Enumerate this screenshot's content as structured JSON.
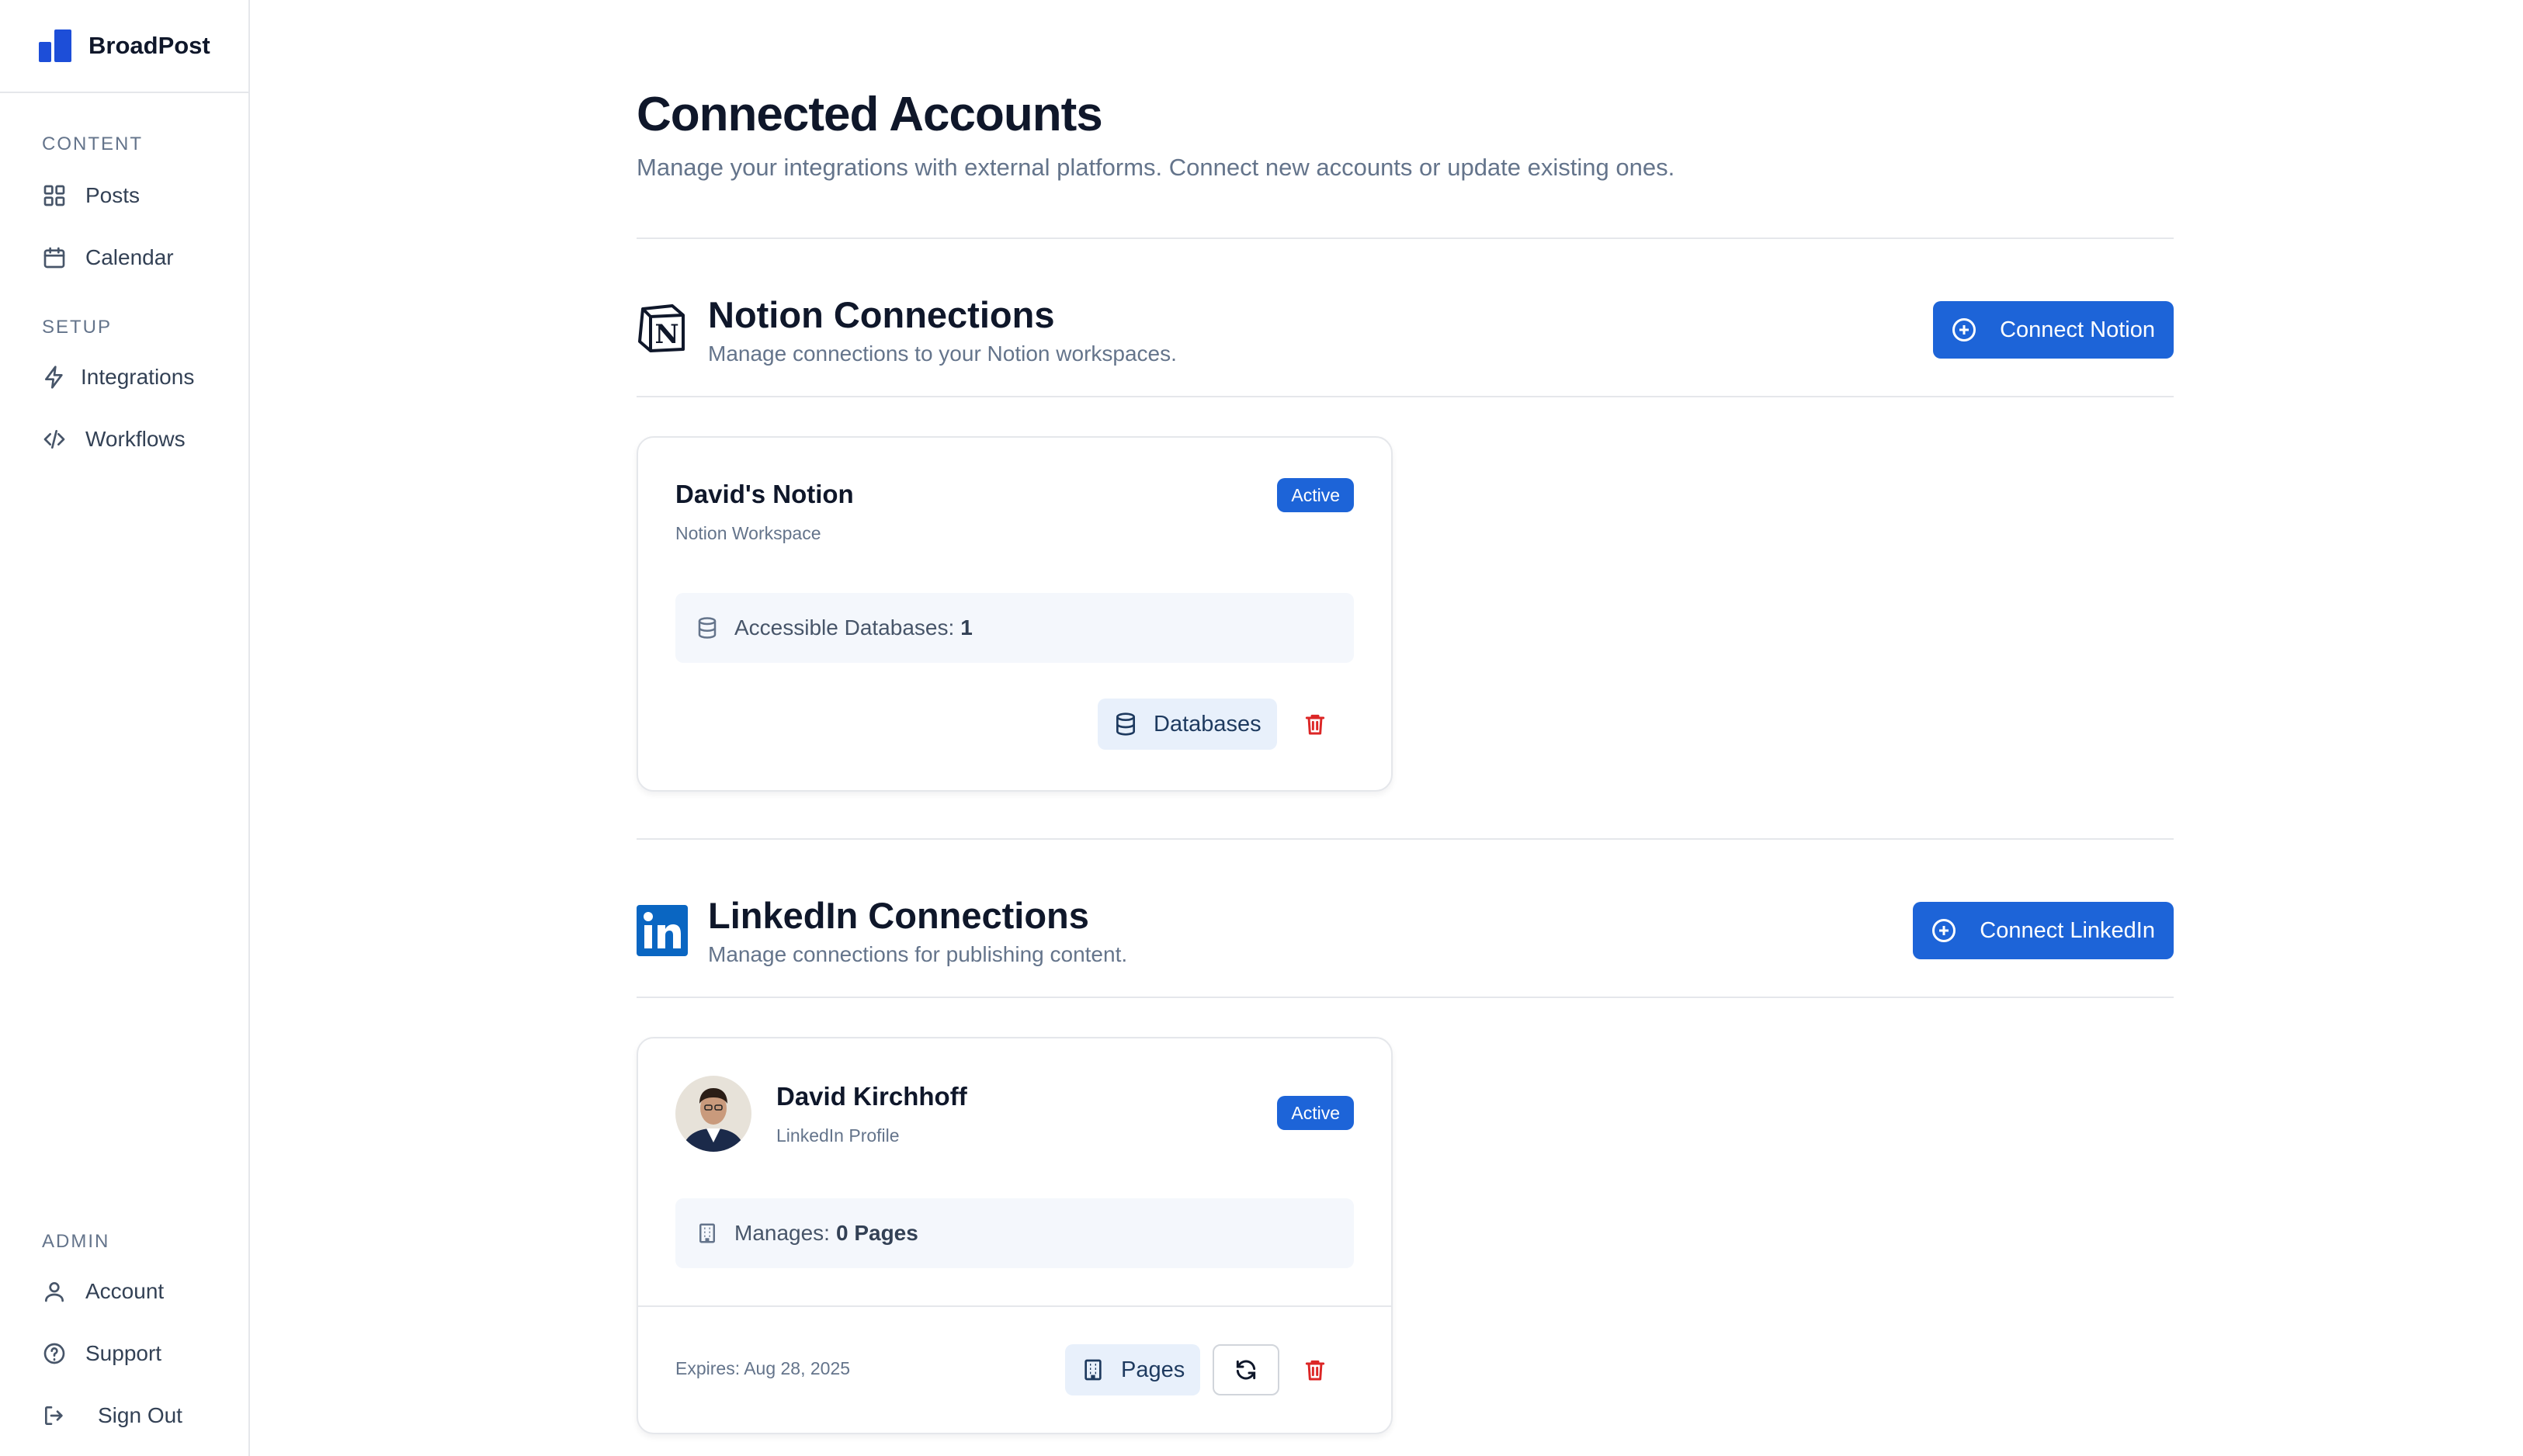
{
  "app": {
    "name": "BroadPost"
  },
  "sidebar": {
    "sections": [
      {
        "label": "CONTENT",
        "items": [
          {
            "label": "Posts",
            "icon": "grid-icon"
          },
          {
            "label": "Calendar",
            "icon": "calendar-icon"
          }
        ]
      },
      {
        "label": "SETUP",
        "items": [
          {
            "label": "Integrations",
            "icon": "bolt-icon"
          },
          {
            "label": "Workflows",
            "icon": "code-icon"
          }
        ]
      },
      {
        "label": "ADMIN",
        "items": [
          {
            "label": "Account",
            "icon": "user-icon"
          },
          {
            "label": "Support",
            "icon": "help-icon"
          },
          {
            "label": "Sign Out",
            "icon": "logout-icon"
          }
        ]
      }
    ]
  },
  "page": {
    "title": "Connected Accounts",
    "subtitle": "Manage your integrations with external platforms. Connect new accounts or update existing ones."
  },
  "notion": {
    "title": "Notion Connections",
    "subtitle": "Manage connections to your Notion workspaces.",
    "connect_label": "Connect Notion",
    "card": {
      "name": "David's Notion",
      "type": "Notion Workspace",
      "status": "Active",
      "info_label": "Accessible Databases:",
      "info_value": "1",
      "databases_label": "Databases"
    }
  },
  "linkedin": {
    "title": "LinkedIn Connections",
    "subtitle": "Manage connections for publishing content.",
    "connect_label": "Connect LinkedIn",
    "card": {
      "name": "David Kirchhoff",
      "type": "LinkedIn Profile",
      "status": "Active",
      "info_label": "Manages:",
      "info_value": "0 Pages",
      "expires": "Expires: Aug 28, 2025",
      "pages_label": "Pages"
    }
  },
  "colors": {
    "primary": "#1d64d8",
    "danger": "#dc2626",
    "linkedin": "#0a66c2"
  }
}
